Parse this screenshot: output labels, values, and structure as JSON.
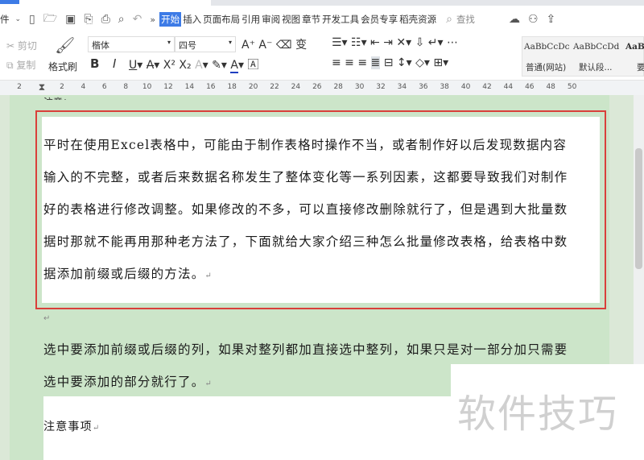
{
  "menu": {
    "file": "件",
    "tabs": [
      "开始",
      "插入",
      "页面布局",
      "引用",
      "审阅",
      "视图",
      "章节",
      "开发工具",
      "会员专享",
      "稻壳资源"
    ],
    "search": "查找"
  },
  "ribbon": {
    "cut": "剪切",
    "copy": "复制",
    "format_painter": "格式刷",
    "font": "楷体",
    "size": "四号",
    "styles": [
      {
        "preview": "AaBbCcDc",
        "label": "普通(网站)"
      },
      {
        "preview": "AaBbCcDd",
        "label": "默认段..."
      },
      {
        "preview": "AaBb",
        "label": "要"
      }
    ]
  },
  "ruler": [
    "2",
    "2",
    "4",
    "6",
    "8",
    "10",
    "12",
    "14",
    "16",
    "18",
    "20",
    "22",
    "24",
    "26",
    "28",
    "30",
    "32",
    "34",
    "36",
    "38",
    "40",
    "42",
    "44",
    "46",
    "48",
    "50"
  ],
  "doc": {
    "top_fragment": "注意：",
    "boxed_lines": [
      "平时在使用Excel表格中，可能由于制作表格时操作不当，或者制作好以后发现数据内容",
      "输入的不完整，或者后来数据名称发生了整体变化等一系列因素，这都要导致我们对制作",
      "好的表格进行修改调整。如果修改的不多，可以直接修改删除就行了，但是遇到大批量数",
      "据时那就不能再用那种老方法了，下面就给大家介绍三种怎么批量修改表格，给表格中数",
      "据添加前缀或后缀的方法。"
    ],
    "para2": [
      "选中要添加前缀或后缀的列，如果对整列都加直接选中整列，如果只是对一部分加只需要",
      "选中要添加的部分就行了。"
    ],
    "note": "注意事项",
    "para_mark": "↵"
  },
  "watermark": "软件技巧"
}
